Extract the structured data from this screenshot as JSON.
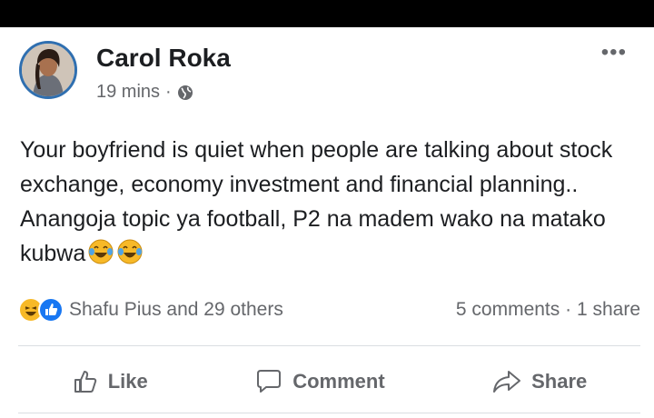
{
  "post": {
    "author": "Carol Roka",
    "time": "19 mins",
    "separator": "·",
    "privacy_icon": "globe-icon",
    "more_icon": "•••",
    "text": "Your boyfriend is quiet when people are talking about stock exchange, economy investment and financial planning.. Anangoja topic ya football, P2 na madem wako na matako kubwa",
    "trailing_emoji": [
      "laughing-tears-emoji",
      "laughing-tears-emoji"
    ]
  },
  "stats": {
    "reaction_icons": [
      "haha-icon",
      "like-icon"
    ],
    "reactions_label": "Shafu Pius and 29 others",
    "comments_label": "5 comments",
    "stats_separator": "·",
    "shares_label": "1 share"
  },
  "actions": {
    "like_label": "Like",
    "comment_label": "Comment",
    "share_label": "Share"
  },
  "colors": {
    "avatar_ring": "#2f6fb0",
    "meta_text": "#65676b",
    "like_blue": "#1877f2",
    "haha_yellow": "#f7b928"
  }
}
